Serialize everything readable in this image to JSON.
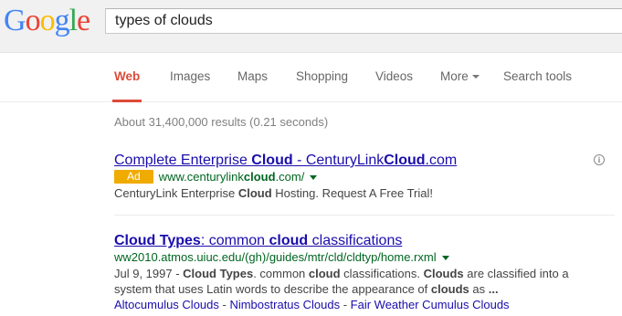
{
  "logo": {
    "letters": [
      "G",
      "o",
      "o",
      "g",
      "l",
      "e"
    ],
    "colors": [
      "#4285f4",
      "#ea4335",
      "#fbbc05",
      "#4285f4",
      "#34a853",
      "#ea4335"
    ]
  },
  "search": {
    "value": "types of clouds"
  },
  "tabs": [
    {
      "label": "Web",
      "active": true
    },
    {
      "label": "Images"
    },
    {
      "label": "Maps"
    },
    {
      "label": "Shopping"
    },
    {
      "label": "Videos"
    },
    {
      "label": "More"
    },
    {
      "label": "Search tools"
    }
  ],
  "stats": "About 31,400,000 results (0.21 seconds)",
  "ad": {
    "title_parts": [
      "Complete Enterprise ",
      "Cloud",
      " - CenturyLink",
      "Cloud",
      ".com"
    ],
    "badge": "Ad",
    "url_parts": [
      "www.centurylink",
      "cloud",
      ".com/"
    ],
    "snippet_parts": [
      "CenturyLink Enterprise ",
      "Cloud",
      " Hosting. Request A Free Trial!"
    ]
  },
  "result1": {
    "title_parts": [
      "Cloud Types",
      ": common ",
      "cloud",
      " classifications"
    ],
    "url": "ww2010.atmos.uiuc.edu/(gh)/guides/mtr/cld/cldtyp/home.rxml",
    "snippet_line1": [
      "Jul 9, 1997 - ",
      "Cloud Types",
      ". common ",
      "cloud",
      " classifications. ",
      "Clouds",
      " are classified into a"
    ],
    "snippet_line2": [
      "system that uses Latin words to describe the appearance of ",
      "clouds",
      " as ",
      "..."
    ],
    "sitelinks": [
      "Altocumulus Clouds",
      "Nimbostratus Clouds",
      "Fair Weather Cumulus Clouds"
    ],
    "sitelink_sep": " - "
  },
  "colors": {
    "accent": "#dd4b39",
    "link": "#1a0dab",
    "url_green": "#006621",
    "ad_badge": "#f0ab00"
  }
}
